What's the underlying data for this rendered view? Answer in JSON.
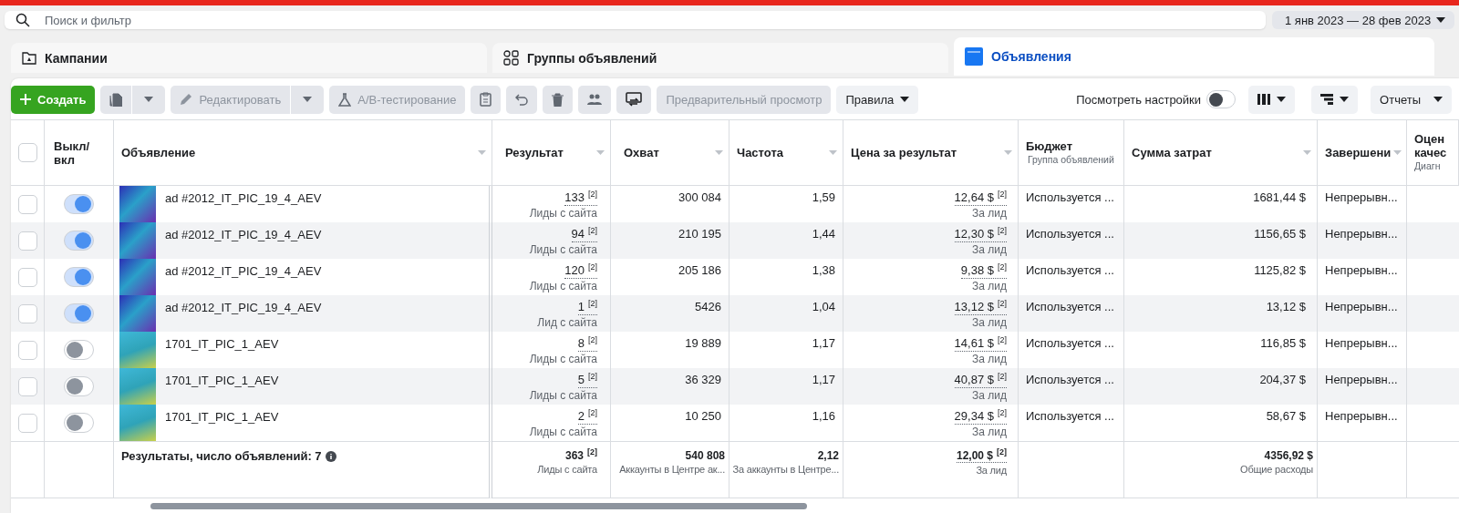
{
  "search": {
    "placeholder": "Поиск и фильтр"
  },
  "date_range": "1 янв 2023 — 28 фев 2023",
  "tabs": [
    {
      "label": "Кампании",
      "kind": "folder",
      "selected": false
    },
    {
      "label": "Группы объявлений",
      "kind": "grid",
      "selected": false
    },
    {
      "label": "Объявления",
      "kind": "ad",
      "selected": true
    }
  ],
  "toolbar": [
    {
      "kind": "create",
      "label": "Создать"
    },
    {
      "kind": "copy",
      "disabled": true
    },
    {
      "kind": "edit",
      "label": "Редактировать",
      "disabled": true
    },
    {
      "kind": "abtest",
      "label": "A/B-тестирование",
      "disabled": true
    },
    {
      "kind": "clipboard",
      "disabled": true
    },
    {
      "kind": "undo",
      "disabled": true
    },
    {
      "kind": "trash",
      "disabled": true
    },
    {
      "kind": "people",
      "disabled": true
    },
    {
      "kind": "swap",
      "disabled": true
    },
    {
      "kind": "preview",
      "label": "Предварительный просмотр",
      "disabled": true
    },
    {
      "kind": "rules",
      "label": "Правила",
      "disabled": false
    }
  ],
  "view_settings": {
    "label": "Посмотреть настройки",
    "on": false
  },
  "reports": "Отчеты",
  "all_selected": false,
  "columns": [
    {
      "label": "Выкл/ вкл",
      "sortable": false
    },
    {
      "label": "Объявление",
      "sortable": true
    },
    {
      "label": "Результат",
      "sortable": true
    },
    {
      "label": "Охват",
      "sortable": true
    },
    {
      "label": "Частота",
      "sortable": true
    },
    {
      "label": "Цена за результат",
      "sortable": true
    },
    {
      "label": "Бюджет",
      "sub": "Группа объявлений",
      "sortable": false
    },
    {
      "label": "Сумма затрат",
      "sortable": true
    },
    {
      "label": "Завершени",
      "sortable": true
    },
    {
      "label": "Оцен качес",
      "sub": "Диагн",
      "sortable": false
    }
  ],
  "rows": [
    {
      "selected": false,
      "on": true,
      "kind": "spine",
      "name": "ad #2012_IT_PIC_19_4_AEV",
      "result": {
        "value": "133",
        "note": "[2]",
        "sub": "Лиды с сайта"
      },
      "reach": "300 084",
      "frequency": "1,59",
      "cost": {
        "value": "12,64 $",
        "note": "[2]",
        "sub": "За лид"
      },
      "budget": "Используется ...",
      "spent": "1681,44 $",
      "end": "Непрерывн..."
    },
    {
      "selected": false,
      "on": true,
      "kind": "spine",
      "name": "ad #2012_IT_PIC_19_4_AEV",
      "result": {
        "value": "94",
        "note": "[2]",
        "sub": "Лиды с сайта"
      },
      "reach": "210 195",
      "frequency": "1,44",
      "cost": {
        "value": "12,30 $",
        "note": "[2]",
        "sub": "За лид"
      },
      "budget": "Используется ...",
      "spent": "1156,65 $",
      "end": "Непрерывн..."
    },
    {
      "selected": false,
      "on": true,
      "kind": "spine",
      "name": "ad #2012_IT_PIC_19_4_AEV",
      "result": {
        "value": "120",
        "note": "[2]",
        "sub": "Лиды с сайта"
      },
      "reach": "205 186",
      "frequency": "1,38",
      "cost": {
        "value": "9,38 $",
        "note": "[2]",
        "sub": "За лид"
      },
      "budget": "Используется ...",
      "spent": "1125,82 $",
      "end": "Непрерывн..."
    },
    {
      "selected": false,
      "on": true,
      "kind": "spine",
      "name": "ad #2012_IT_PIC_19_4_AEV",
      "result": {
        "value": "1",
        "note": "[2]",
        "sub": "Лид с сайта"
      },
      "reach": "5426",
      "frequency": "1,04",
      "cost": {
        "value": "13,12 $",
        "note": "[2]",
        "sub": "За лид"
      },
      "budget": "Используется ...",
      "spent": "13,12 $",
      "end": "Непрерывн..."
    },
    {
      "selected": false,
      "on": false,
      "kind": "figure",
      "name": "1701_IT_PIC_1_AEV",
      "result": {
        "value": "8",
        "note": "[2]",
        "sub": "Лиды с сайта"
      },
      "reach": "19 889",
      "frequency": "1,17",
      "cost": {
        "value": "14,61 $",
        "note": "[2]",
        "sub": "За лид"
      },
      "budget": "Используется ...",
      "spent": "116,85 $",
      "end": "Непрерывн..."
    },
    {
      "selected": false,
      "on": false,
      "kind": "figure",
      "name": "1701_IT_PIC_1_AEV",
      "result": {
        "value": "5",
        "note": "[2]",
        "sub": "Лиды с сайта"
      },
      "reach": "36 329",
      "frequency": "1,17",
      "cost": {
        "value": "40,87 $",
        "note": "[2]",
        "sub": "За лид"
      },
      "budget": "Используется ...",
      "spent": "204,37 $",
      "end": "Непрерывн..."
    },
    {
      "selected": false,
      "on": false,
      "kind": "figure",
      "name": "1701_IT_PIC_1_AEV",
      "result": {
        "value": "2",
        "note": "[2]",
        "sub": "Лиды с сайта"
      },
      "reach": "10 250",
      "frequency": "1,16",
      "cost": {
        "value": "29,34 $",
        "note": "[2]",
        "sub": "За лид"
      },
      "budget": "Используется ...",
      "spent": "58,67 $",
      "end": "Непрерывн..."
    }
  ],
  "totals": {
    "label": "Результаты, число объявлений: 7",
    "result": {
      "value": "363",
      "note": "[2]",
      "sub": "Лиды с сайта"
    },
    "reach": {
      "value": "540 808",
      "sub": "Аккаунты в Центре ак..."
    },
    "frequency": {
      "value": "2,12",
      "sub": "За аккаунты в Центре..."
    },
    "cost": {
      "value": "12,00 $",
      "note": "[2]",
      "sub": "За лид"
    },
    "spent": {
      "value": "4356,92 $",
      "sub": "Общие расходы"
    }
  }
}
